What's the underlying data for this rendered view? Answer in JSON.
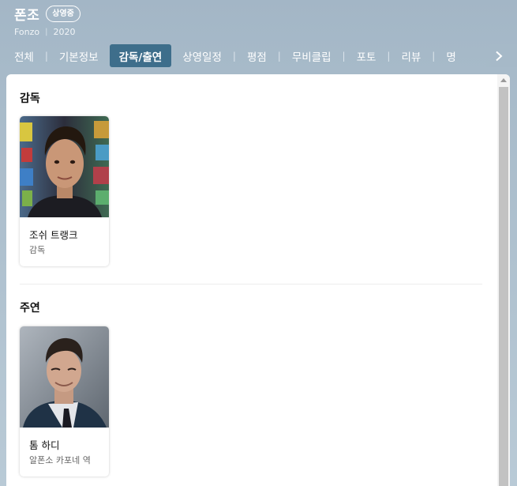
{
  "movie": {
    "title": "폰조",
    "status_badge": "상영중",
    "english_title": "Fonzo",
    "separator": "|",
    "year": "2020"
  },
  "tabs": [
    {
      "label": "전체",
      "active": false
    },
    {
      "label": "기본정보",
      "active": false
    },
    {
      "label": "감독/출연",
      "active": true
    },
    {
      "label": "상영일정",
      "active": false
    },
    {
      "label": "평점",
      "active": false
    },
    {
      "label": "무비클립",
      "active": false
    },
    {
      "label": "포토",
      "active": false
    },
    {
      "label": "리뷰",
      "active": false
    },
    {
      "label": "명",
      "active": false
    }
  ],
  "tab_separator": "|",
  "sections": [
    {
      "title": "감독",
      "people": [
        {
          "name": "조쉬 트랭크",
          "role": "감독"
        }
      ]
    },
    {
      "title": "주연",
      "people": [
        {
          "name": "톰 하디",
          "role": "알폰소 카포네 역"
        }
      ]
    }
  ],
  "icons": {
    "tab_next": "chevron-right-icon",
    "scroll_up": "triangle-up-icon"
  },
  "colors": {
    "active_tab": "#3e6e8b",
    "header_bg": "#a3b6c6"
  }
}
